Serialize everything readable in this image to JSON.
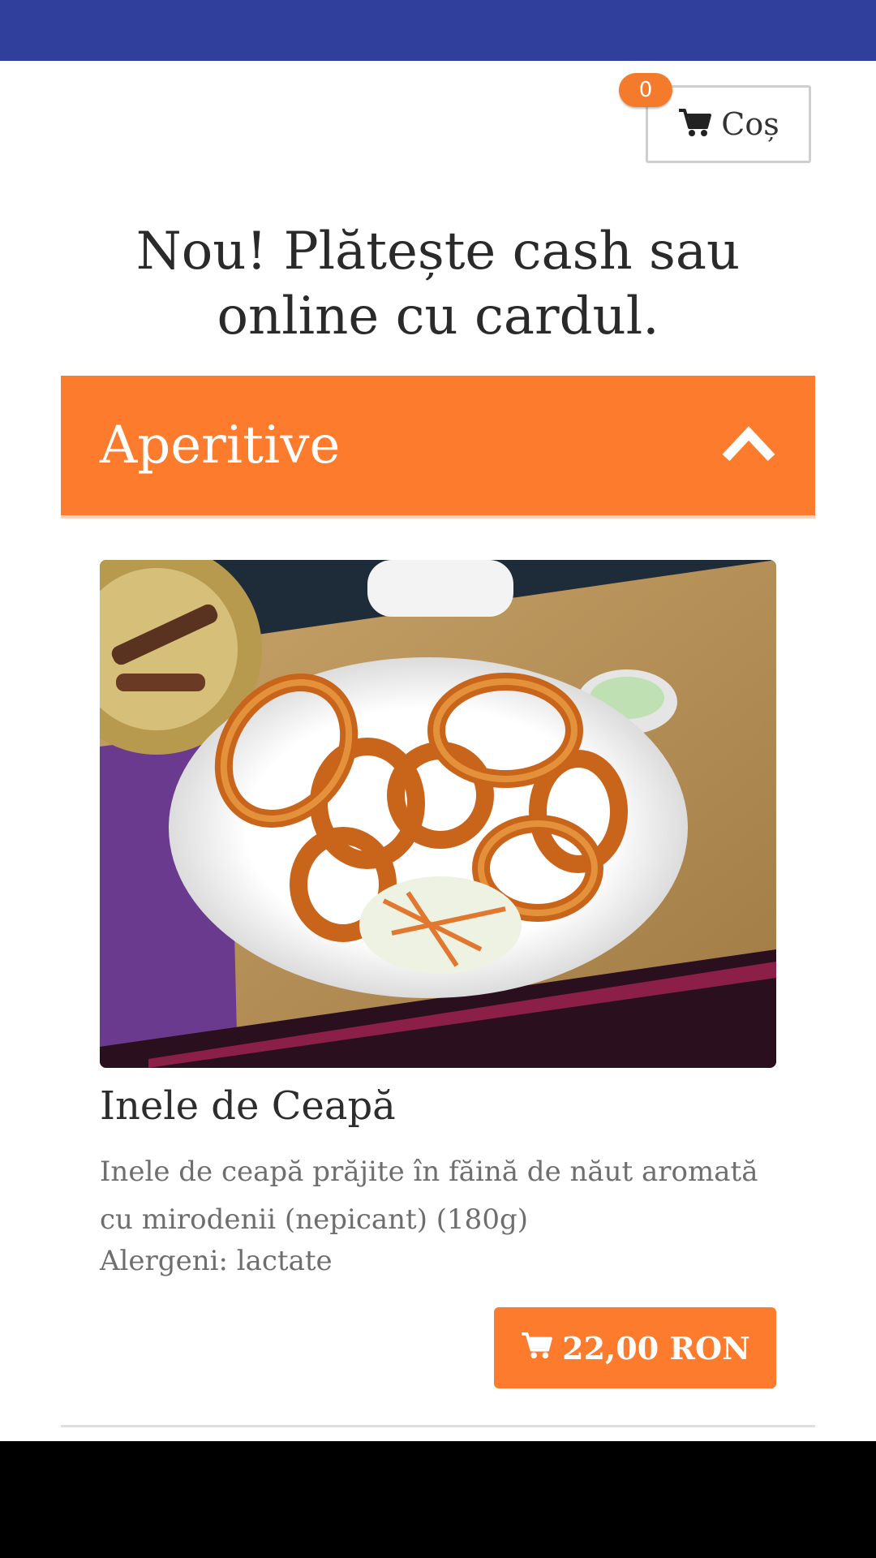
{
  "cart": {
    "count": "0",
    "label": "Coș"
  },
  "promo": {
    "text": "Nou! Plătește cash sau online cu cardul."
  },
  "category": {
    "title": "Aperitive"
  },
  "item": {
    "name": "Inele de Ceapă",
    "description": "Inele de ceapă prăjite în făină de năut aromată cu mirodenii (nepicant) (180g)",
    "allergens": "Alergeni: lactate",
    "price": "22,00 RON"
  },
  "colors": {
    "nav": "#2f3f9b",
    "accent": "#fd7b2d"
  },
  "icons": {
    "cart": "cart-icon",
    "collapse": "chevron-up-icon"
  }
}
